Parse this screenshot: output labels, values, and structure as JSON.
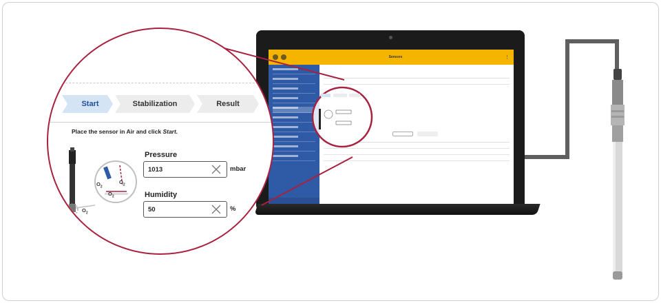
{
  "wizard": {
    "steps": [
      {
        "label": "Start",
        "active": true
      },
      {
        "label": "Stabilization",
        "active": false
      },
      {
        "label": "Result",
        "active": false
      }
    ],
    "instruction_prefix": "Place the sensor in Air and click ",
    "instruction_action": "Start.",
    "pressure": {
      "label": "Pressure",
      "value": "1013",
      "unit": "mbar"
    },
    "humidity": {
      "label": "Humidity",
      "value": "50",
      "unit": "%"
    },
    "o2_label": "O",
    "o2_sub": "2"
  },
  "app": {
    "header_title": "Sensors"
  },
  "colors": {
    "accent": "#a8213f",
    "app_bar": "#f5b400",
    "nav": "#2e5aa6",
    "step_active_bg": "#d5e4f4"
  }
}
